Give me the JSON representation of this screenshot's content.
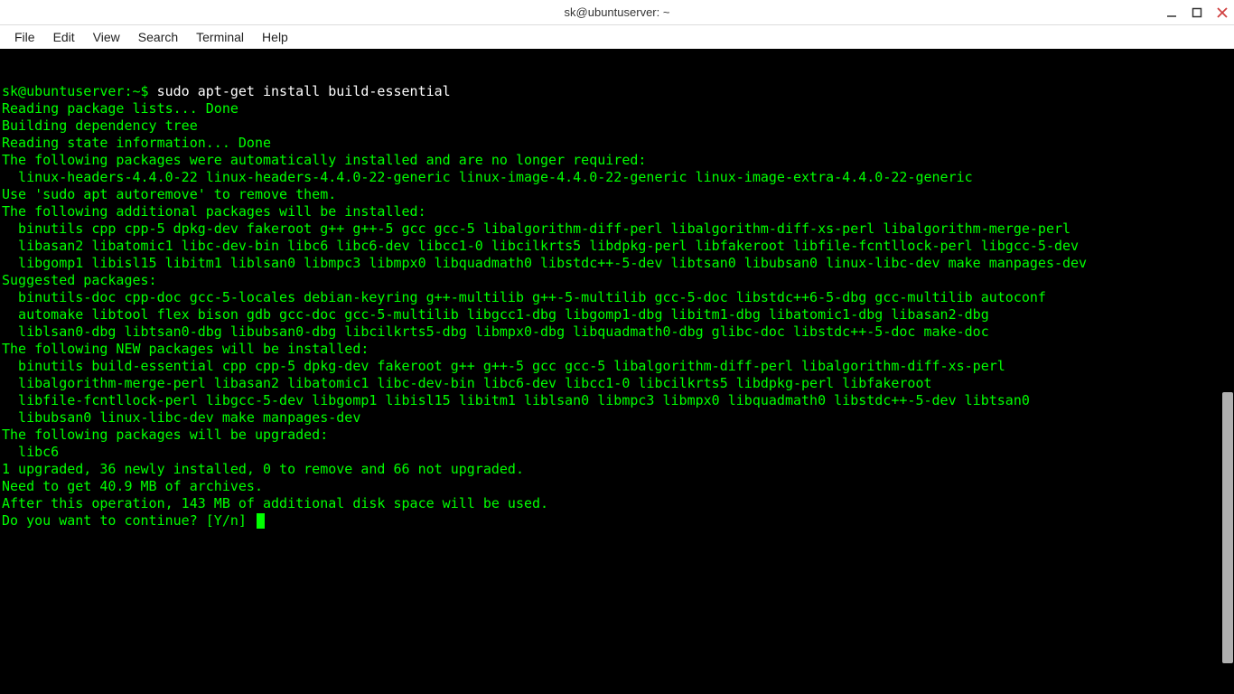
{
  "window": {
    "title": "sk@ubuntuserver: ~"
  },
  "menubar": {
    "items": [
      "File",
      "Edit",
      "View",
      "Search",
      "Terminal",
      "Help"
    ]
  },
  "terminal": {
    "prompt_user_host": "sk@ubuntuserver",
    "prompt_path": "~",
    "prompt_suffix": "$ ",
    "command": "sudo apt-get install build-essential",
    "lines": [
      "Reading package lists... Done",
      "Building dependency tree       ",
      "Reading state information... Done",
      "The following packages were automatically installed and are no longer required:",
      "  linux-headers-4.4.0-22 linux-headers-4.4.0-22-generic linux-image-4.4.0-22-generic linux-image-extra-4.4.0-22-generic",
      "Use 'sudo apt autoremove' to remove them.",
      "The following additional packages will be installed:",
      "  binutils cpp cpp-5 dpkg-dev fakeroot g++ g++-5 gcc gcc-5 libalgorithm-diff-perl libalgorithm-diff-xs-perl libalgorithm-merge-perl",
      "  libasan2 libatomic1 libc-dev-bin libc6 libc6-dev libcc1-0 libcilkrts5 libdpkg-perl libfakeroot libfile-fcntllock-perl libgcc-5-dev",
      "  libgomp1 libisl15 libitm1 liblsan0 libmpc3 libmpx0 libquadmath0 libstdc++-5-dev libtsan0 libubsan0 linux-libc-dev make manpages-dev",
      "Suggested packages:",
      "  binutils-doc cpp-doc gcc-5-locales debian-keyring g++-multilib g++-5-multilib gcc-5-doc libstdc++6-5-dbg gcc-multilib autoconf",
      "  automake libtool flex bison gdb gcc-doc gcc-5-multilib libgcc1-dbg libgomp1-dbg libitm1-dbg libatomic1-dbg libasan2-dbg",
      "  liblsan0-dbg libtsan0-dbg libubsan0-dbg libcilkrts5-dbg libmpx0-dbg libquadmath0-dbg glibc-doc libstdc++-5-doc make-doc",
      "The following NEW packages will be installed:",
      "  binutils build-essential cpp cpp-5 dpkg-dev fakeroot g++ g++-5 gcc gcc-5 libalgorithm-diff-perl libalgorithm-diff-xs-perl",
      "  libalgorithm-merge-perl libasan2 libatomic1 libc-dev-bin libc6-dev libcc1-0 libcilkrts5 libdpkg-perl libfakeroot",
      "  libfile-fcntllock-perl libgcc-5-dev libgomp1 libisl15 libitm1 liblsan0 libmpc3 libmpx0 libquadmath0 libstdc++-5-dev libtsan0",
      "  libubsan0 linux-libc-dev make manpages-dev",
      "The following packages will be upgraded:",
      "  libc6",
      "1 upgraded, 36 newly installed, 0 to remove and 66 not upgraded.",
      "Need to get 40.9 MB of archives.",
      "After this operation, 143 MB of additional disk space will be used."
    ],
    "continue_prompt": "Do you want to continue? [Y/n] "
  }
}
